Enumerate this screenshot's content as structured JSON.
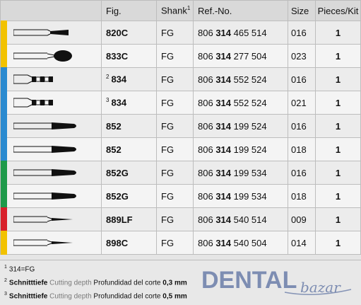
{
  "header": {
    "fig": "Fig.",
    "shank": "Shank",
    "shank_sup": "1",
    "ref": "Ref.-No.",
    "size": "Size",
    "pieces": "Pieces/Kit"
  },
  "rows": [
    {
      "color": "#f2c200",
      "sup": "",
      "fig": "820C",
      "shank": "FG",
      "ref_pre": "806",
      "ref_mid": "314",
      "ref_post": "465 514",
      "size": "016",
      "pieces": "1",
      "icon": "cone-bur-icon"
    },
    {
      "color": "#f2c200",
      "sup": "",
      "fig": "833C",
      "shank": "FG",
      "ref_pre": "806",
      "ref_mid": "314",
      "ref_post": "277 504",
      "size": "023",
      "pieces": "1",
      "icon": "oval-bur-icon"
    },
    {
      "color": "#2a8ad0",
      "sup": "2",
      "fig": "834",
      "shank": "FG",
      "ref_pre": "806",
      "ref_mid": "314",
      "ref_post": "552 524",
      "size": "016",
      "pieces": "1",
      "icon": "depth-marker-bur-icon"
    },
    {
      "color": "#2a8ad0",
      "sup": "3",
      "fig": "834",
      "shank": "FG",
      "ref_pre": "806",
      "ref_mid": "314",
      "ref_post": "552 524",
      "size": "021",
      "pieces": "1",
      "icon": "depth-marker-bur-icon"
    },
    {
      "color": "#2a8ad0",
      "sup": "",
      "fig": "852",
      "shank": "FG",
      "ref_pre": "806",
      "ref_mid": "314",
      "ref_post": "199 524",
      "size": "016",
      "pieces": "1",
      "icon": "taper-bur-icon"
    },
    {
      "color": "#2a8ad0",
      "sup": "",
      "fig": "852",
      "shank": "FG",
      "ref_pre": "806",
      "ref_mid": "314",
      "ref_post": "199 524",
      "size": "018",
      "pieces": "1",
      "icon": "taper-bur-icon"
    },
    {
      "color": "#1f9a4a",
      "sup": "",
      "fig": "852G",
      "shank": "FG",
      "ref_pre": "806",
      "ref_mid": "314",
      "ref_post": "199 534",
      "size": "016",
      "pieces": "1",
      "icon": "taper-bur-icon"
    },
    {
      "color": "#1f9a4a",
      "sup": "",
      "fig": "852G",
      "shank": "FG",
      "ref_pre": "806",
      "ref_mid": "314",
      "ref_post": "199 534",
      "size": "018",
      "pieces": "1",
      "icon": "taper-bur-icon"
    },
    {
      "color": "#d8202a",
      "sup": "",
      "fig": "889LF",
      "shank": "FG",
      "ref_pre": "806",
      "ref_mid": "314",
      "ref_post": "540 514",
      "size": "009",
      "pieces": "1",
      "icon": "needle-bur-icon"
    },
    {
      "color": "#f2c200",
      "sup": "",
      "fig": "898C",
      "shank": "FG",
      "ref_pre": "806",
      "ref_mid": "314",
      "ref_post": "540 504",
      "size": "014",
      "pieces": "1",
      "icon": "needle-bur-icon"
    }
  ],
  "footnotes": [
    {
      "sup": "1",
      "text": "314=FG",
      "gray": "",
      "es": "",
      "val": ""
    },
    {
      "sup": "2",
      "text": "Schnitttiefe",
      "gray": "Cutting depth",
      "es": "Profundidad del corte",
      "val": "0,3 mm"
    },
    {
      "sup": "3",
      "text": "Schnitttiefe",
      "gray": "Cutting depth",
      "es": "Profundidad del corte",
      "val": "0,5 mm"
    }
  ],
  "logo": {
    "main": "DENTAL",
    "script": "bazar",
    "color": "#5a6fa0"
  }
}
